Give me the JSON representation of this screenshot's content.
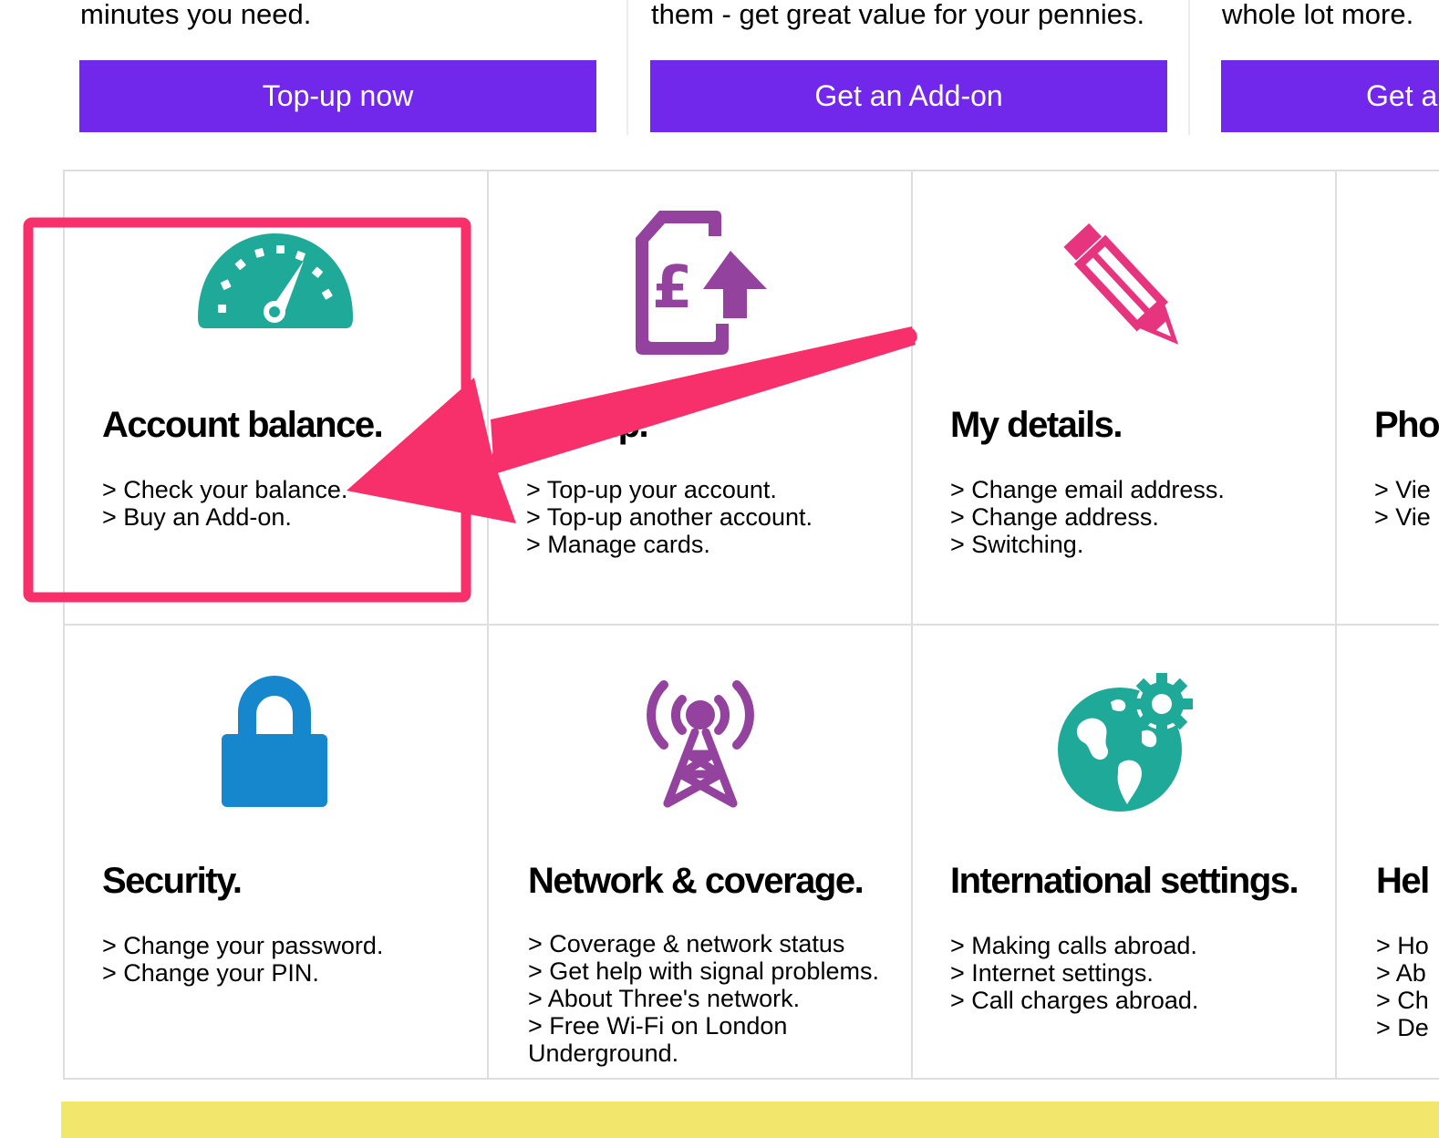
{
  "promos": [
    {
      "text": "minutes you need.",
      "button": "Top-up now"
    },
    {
      "text": "them - get great value for your pennies.",
      "button": "Get an Add-on"
    },
    {
      "text": "whole lot more.",
      "button": "Get a"
    }
  ],
  "tiles": [
    {
      "title": "Account balance.",
      "icon": "speedometer-icon",
      "links": [
        "> Check your balance.",
        "> Buy an Add-on."
      ]
    },
    {
      "title": "Top-up.",
      "icon": "sim-topup-icon",
      "links": [
        "> Top-up your account.",
        "> Top-up another account.",
        "> Manage cards."
      ]
    },
    {
      "title": "My details.",
      "icon": "pencil-icon",
      "links": [
        "> Change email address.",
        "> Change address.",
        "> Switching."
      ]
    },
    {
      "title": "Pho",
      "icon": "phone-icon",
      "links": [
        "> Vie",
        "> Vie"
      ]
    },
    {
      "title": "Security.",
      "icon": "padlock-icon",
      "links": [
        "> Change your password.",
        "> Change your PIN."
      ]
    },
    {
      "title": "Network & coverage.",
      "icon": "signal-tower-icon",
      "links": [
        "> Coverage & network status",
        "> Get help with signal problems.",
        "> About Three's network.",
        "> Free Wi-Fi on London Underground."
      ]
    },
    {
      "title": "International settings.",
      "icon": "globe-gear-icon",
      "links": [
        "> Making calls abroad.",
        "> Internet settings.",
        "> Call charges abroad."
      ]
    },
    {
      "title": "Hel",
      "icon": "help-icon",
      "links": [
        "> Ho",
        "> Ab",
        "> Ch",
        "> De"
      ]
    }
  ],
  "colors": {
    "button_purple": "#7128ea",
    "annotation_pink": "#f7306b",
    "teal": "#1fa999",
    "purple_icon": "#93439d",
    "pink_icon": "#e6347f",
    "blue_icon": "#1687cc",
    "footer_yellow": "#f3e66d"
  }
}
